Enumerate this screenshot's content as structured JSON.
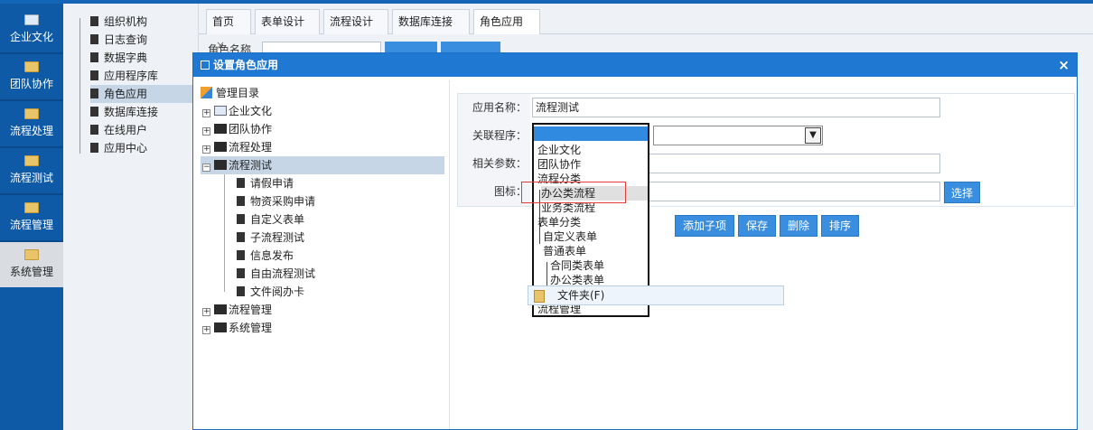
{
  "left_nav": [
    {
      "label": "企业文化",
      "icon": "id-card-icon"
    },
    {
      "label": "团队协作",
      "icon": "folder-icon"
    },
    {
      "label": "流程处理",
      "icon": "folder-icon"
    },
    {
      "label": "流程测试",
      "icon": "folder-icon"
    },
    {
      "label": "流程管理",
      "icon": "folder-icon"
    },
    {
      "label": "系统管理",
      "icon": "folder-icon",
      "active": true
    }
  ],
  "sub_nav": [
    {
      "label": "组织机构"
    },
    {
      "label": "日志查询"
    },
    {
      "label": "数据字典"
    },
    {
      "label": "应用程序库"
    },
    {
      "label": "角色应用",
      "active": true
    },
    {
      "label": "数据库连接"
    },
    {
      "label": "在线用户"
    },
    {
      "label": "应用中心"
    }
  ],
  "tabs": [
    {
      "label": "首页",
      "close": "×"
    },
    {
      "label": "表单设计",
      "close": "×"
    },
    {
      "label": "流程设计",
      "close": "×"
    },
    {
      "label": "数据库连接",
      "close": "×"
    },
    {
      "label": "角色应用",
      "close": "×",
      "active": true
    }
  ],
  "background": {
    "role_name_label": "角色名称"
  },
  "dialog": {
    "title": "设置角色应用",
    "close": "×",
    "tree": {
      "root": "管理目录",
      "nodes": [
        {
          "label": "企业文化",
          "expander": "+"
        },
        {
          "label": "团队协作",
          "expander": "+"
        },
        {
          "label": "流程处理",
          "expander": "+"
        },
        {
          "label": "流程测试",
          "expander": "−",
          "selected": true
        },
        {
          "label": "请假申请"
        },
        {
          "label": "物资采购申请"
        },
        {
          "label": "自定义表单"
        },
        {
          "label": "子流程测试"
        },
        {
          "label": "信息发布"
        },
        {
          "label": "自由流程测试"
        },
        {
          "label": "文件阅办卡"
        },
        {
          "label": "流程管理",
          "expander": "+"
        },
        {
          "label": "系统管理",
          "expander": "+"
        }
      ]
    },
    "form": {
      "app_name_label": "应用名称：",
      "app_name_value": "流程测试",
      "program_label": "关联程序：",
      "params_label": "相关参数：",
      "icon_label": "图标：",
      "choose_button": "选择"
    },
    "buttons": {
      "add_child": "添加子项",
      "save": "保存",
      "delete": "删除",
      "sort": "排序"
    },
    "dropdown": {
      "items": [
        {
          "label": "企业文化",
          "depth": 0
        },
        {
          "label": "团队协作",
          "depth": 0
        },
        {
          "label": "流程分类",
          "depth": 0
        },
        {
          "label": "办公类流程",
          "depth": 1,
          "highlight": true
        },
        {
          "label": "业务类流程",
          "depth": 1
        },
        {
          "label": "表单分类",
          "depth": 0
        },
        {
          "label": "自定义表单",
          "depth": 1
        },
        {
          "label": "普通表单",
          "depth": 1
        },
        {
          "label": "合同类表单",
          "depth": 2
        },
        {
          "label": "办公类表单",
          "depth": 2
        },
        {
          "label": "流程管理",
          "depth": 0
        }
      ]
    },
    "drag_tooltip": {
      "label": "文件夹(F)"
    }
  },
  "colors": {
    "nav_blue": "#0f5aa6",
    "dialog_header": "#1f78d1",
    "button_blue": "#3a8ee0",
    "selection_blue": "#2f8ae0",
    "highlight_red": "#e03c3c"
  }
}
